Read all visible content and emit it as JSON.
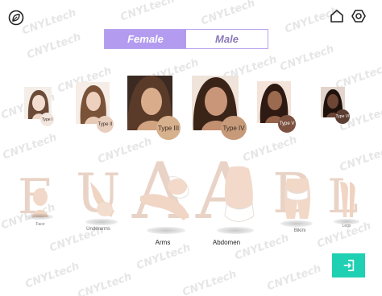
{
  "brand": {
    "watermark": "CNYLtech"
  },
  "header": {
    "logo_icon": "leaf-circle-icon",
    "home_icon": "home-icon",
    "settings_icon": "hexagon-gear-icon"
  },
  "gender_toggle": {
    "female_label": "Female",
    "male_label": "Male",
    "selected": "Female",
    "accent_color": "#b39cf0"
  },
  "skin_types": [
    {
      "label": "Type I",
      "badge_color": "#f3e6df"
    },
    {
      "label": "Type II",
      "badge_color": "#e8cfbd"
    },
    {
      "label": "Type III",
      "badge_color": "#d7b08d"
    },
    {
      "label": "Type IV",
      "badge_color": "#c79a7a"
    },
    {
      "label": "Type V",
      "badge_color": "#7d5140"
    },
    {
      "label": "Type VI",
      "badge_color": "#5c3d31"
    }
  ],
  "body_areas": [
    {
      "letter": "F",
      "label": "Face"
    },
    {
      "letter": "U",
      "label": "Underarms"
    },
    {
      "letter": "A",
      "label": "Arms"
    },
    {
      "letter": "A",
      "label": "Abdomen"
    },
    {
      "letter": "B",
      "label": "Bikini"
    },
    {
      "letter": "L",
      "label": "Legs"
    }
  ],
  "footer": {
    "exit_icon": "exit-door-icon",
    "exit_color": "#1fd0b3"
  }
}
